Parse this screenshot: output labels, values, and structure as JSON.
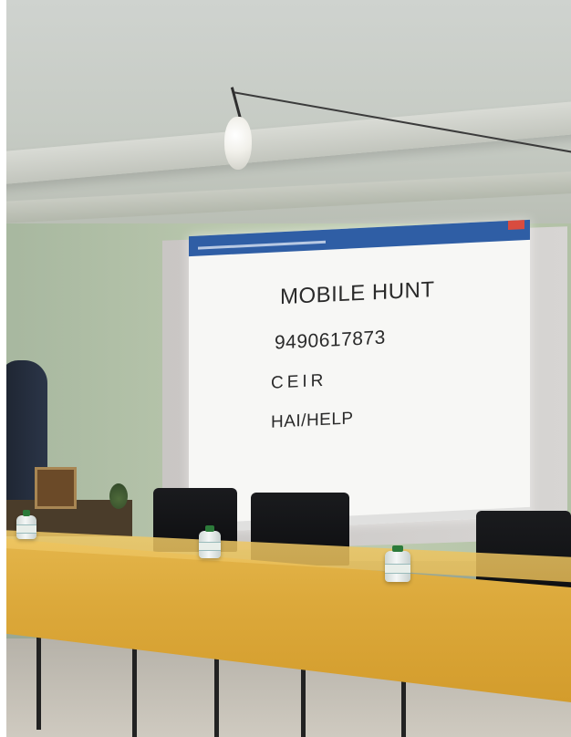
{
  "photo": {
    "projected_slide": {
      "lines": [
        "MOBILE HUNT",
        "9490617873",
        "CEIR",
        "HAI/HELP"
      ]
    }
  }
}
